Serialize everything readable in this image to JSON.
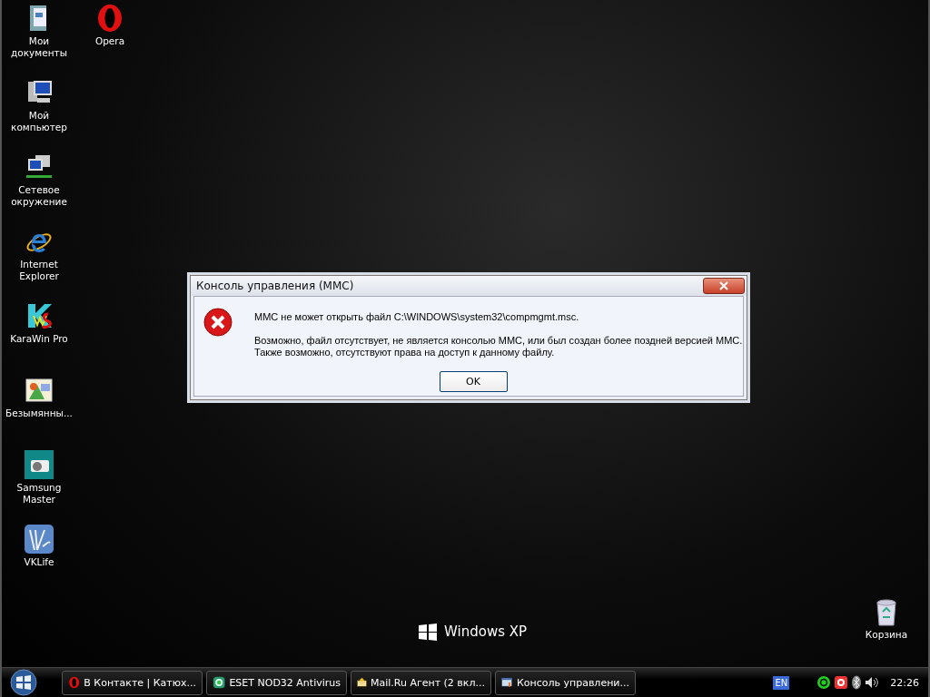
{
  "desktop_icons": [
    {
      "label": "Мои документы",
      "kind": "documents"
    },
    {
      "label": "Мой компьютер",
      "kind": "computer"
    },
    {
      "label": "Сетевое окружение",
      "kind": "network"
    },
    {
      "label": "Internet Explorer",
      "kind": "ie"
    },
    {
      "label": "KaraWin Pro",
      "kind": "karawin"
    },
    {
      "label": "Безымянны...",
      "kind": "image"
    },
    {
      "label": "Samsung Master",
      "kind": "camera"
    },
    {
      "label": "VKLife",
      "kind": "vklife"
    },
    {
      "label": "Opera",
      "kind": "opera"
    }
  ],
  "recycle_bin": {
    "label": "Корзина"
  },
  "wallpaper_logo": "Windows XP",
  "dialog": {
    "title": "Консоль управления (MMC)",
    "message": "MMC не может открыть файл C:\\WINDOWS\\system32\\compmgmt.msc.",
    "detail": [
      "Возможно, файл отсутствует, не является консолью MMC, или был создан более поздней версией MMC.",
      "Также возможно, отсутствуют права на доступ к данному файлу."
    ],
    "ok": "OK"
  },
  "taskbar": {
    "buttons": [
      {
        "label": "В Контакте | Катюх...",
        "kind": "opera"
      },
      {
        "label": "ESET NOD32 Antivirus",
        "kind": "eset"
      },
      {
        "label": "Mail.Ru Агент (2 вкл...",
        "kind": "mail"
      },
      {
        "label": "Консоль управлени...",
        "kind": "mmc"
      }
    ],
    "language": "EN",
    "clock": "22:26"
  }
}
